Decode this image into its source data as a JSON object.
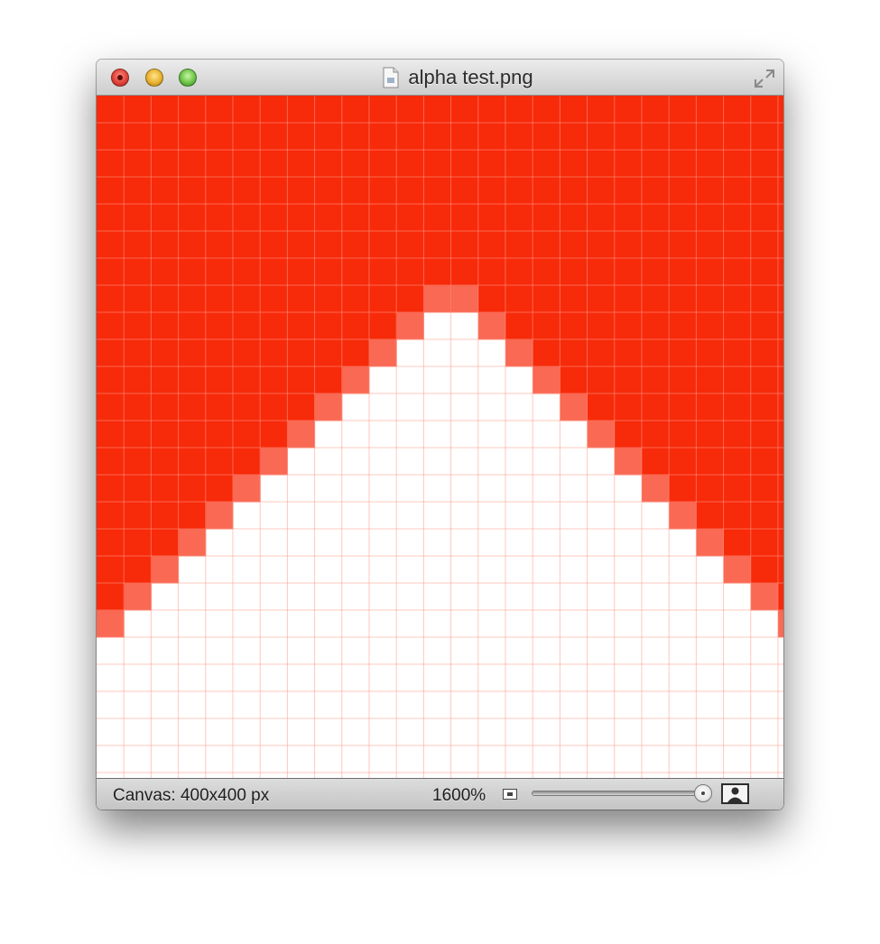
{
  "window": {
    "title": "alpha test.png",
    "file_icon": "document-icon"
  },
  "titlebar_buttons": [
    {
      "name": "close",
      "color": "#e0443a"
    },
    {
      "name": "minimize",
      "color": "#e9b230"
    },
    {
      "name": "zoom",
      "color": "#6cc548"
    }
  ],
  "canvas": {
    "fill_color": "#f72a0a",
    "background_color": "#ffffff",
    "grid_color": "#ff9b8b",
    "pixel_columns": 26,
    "pixel_rows": 25
  },
  "statusbar": {
    "canvas_size": "Canvas: 400x400 px",
    "zoom_level": "1600%",
    "zoom_slider_value": 1.0,
    "small_icon": "image-small-icon",
    "large_icon": "image-large-icon"
  }
}
